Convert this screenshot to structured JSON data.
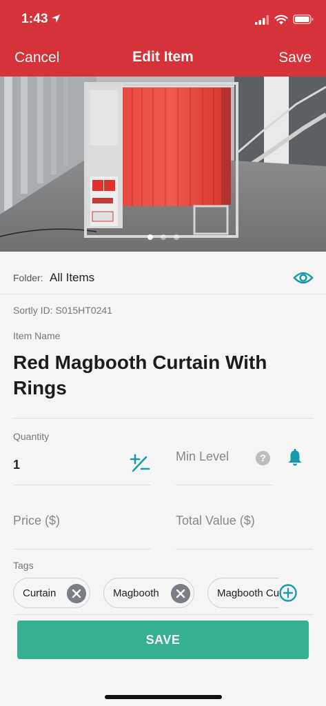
{
  "status": {
    "time": "1:43"
  },
  "nav": {
    "cancel": "Cancel",
    "title": "Edit Item",
    "save": "Save"
  },
  "photos": {
    "count": 3,
    "active_index": 0
  },
  "folder": {
    "label": "Folder:",
    "value": "All Items"
  },
  "sortly_id": "Sortly ID: S015HT0241",
  "item_name": {
    "label": "Item Name",
    "value": "Red Magbooth Curtain With Rings"
  },
  "quantity": {
    "label": "Quantity",
    "value": "1"
  },
  "min_level": {
    "placeholder": "Min Level"
  },
  "price": {
    "placeholder": "Price ($)"
  },
  "total_value": {
    "placeholder": "Total Value ($)"
  },
  "tags": {
    "label": "Tags",
    "items": [
      {
        "label": "Curtain"
      },
      {
        "label": "Magbooth"
      },
      {
        "label": "Magbooth Curtain"
      }
    ]
  },
  "save_button": {
    "label": "SAVE"
  },
  "icons": {
    "location": "location-arrow-icon",
    "eye": "eye-icon",
    "quantity_adjust": "plus-minus-icon",
    "help": "question-icon",
    "alert": "bell-icon",
    "remove_tag": "close-circle-icon",
    "add_tag": "plus-circle-icon"
  },
  "colors": {
    "header": "#d6323a",
    "accent": "#1a9aad",
    "save": "#35b090"
  }
}
